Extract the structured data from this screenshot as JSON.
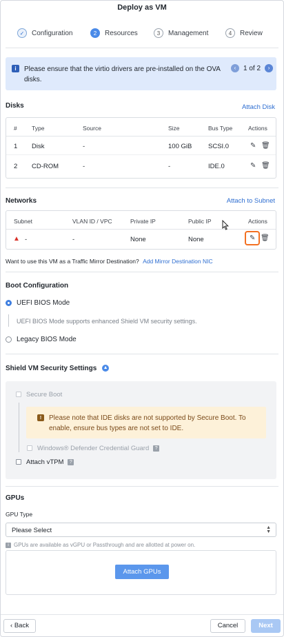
{
  "dialog": {
    "title": "Deploy as VM"
  },
  "steps": [
    {
      "num": "✓",
      "label": "Configuration"
    },
    {
      "num": "2",
      "label": "Resources"
    },
    {
      "num": "3",
      "label": "Management"
    },
    {
      "num": "4",
      "label": "Review"
    }
  ],
  "banner": {
    "message": "Please ensure that the virtio drivers are pre-installed on the OVA disks.",
    "pager": "1 of 2"
  },
  "disks": {
    "title": "Disks",
    "action": "Attach Disk",
    "columns": [
      "#",
      "Type",
      "Source",
      "Size",
      "Bus Type",
      "Actions"
    ],
    "rows": [
      {
        "num": "1",
        "type": "Disk",
        "source": "-",
        "size": "100 GiB",
        "bus": "SCSI.0"
      },
      {
        "num": "2",
        "type": "CD-ROM",
        "source": "-",
        "size": "-",
        "bus": "IDE.0"
      }
    ]
  },
  "networks": {
    "title": "Networks",
    "action": "Attach to Subnet",
    "columns": [
      "Subnet",
      "VLAN ID / VPC",
      "Private IP",
      "Public IP",
      "Actions"
    ],
    "rows": [
      {
        "subnet": "-",
        "vlan": "-",
        "private_ip": "None",
        "public_ip": "None"
      }
    ]
  },
  "mirror": {
    "question": "Want to use this VM as a Traffic Mirror Destination?",
    "link": "Add Mirror Destination NIC"
  },
  "boot": {
    "title": "Boot Configuration",
    "uefi_label": "UEFI BIOS Mode",
    "uefi_help": "UEFI BIOS Mode supports enhanced Shield VM security settings.",
    "legacy_label": "Legacy BIOS Mode"
  },
  "shield": {
    "title": "Shield VM Security Settings",
    "secure_boot": "Secure Boot",
    "warning": "Please note that IDE disks are not supported by Secure Boot. To enable, ensure bus types are not set to IDE.",
    "credential_guard": "Windows® Defender Credential Guard",
    "vtpm": "Attach vTPM"
  },
  "gpus": {
    "title": "GPUs",
    "type_label": "GPU Type",
    "select_value": "Please Select",
    "note": "GPUs are available as vGPU or Passthrough and are allotted at power on.",
    "attach_button": "Attach GPUs"
  },
  "footer": {
    "back": "Back",
    "cancel": "Cancel",
    "next": "Next"
  },
  "colors": {
    "accent": "#4a8ae8",
    "link": "#2e6ed1",
    "banner_bg": "#dfeafc",
    "warning_bg": "#fdf1d9",
    "highlight": "#f37021",
    "error": "#d9342b"
  },
  "icons": [
    "check-icon",
    "info-icon",
    "chevron-left-icon",
    "chevron-right-icon",
    "pencil-icon",
    "trash-icon",
    "alert-triangle-icon",
    "chevron-up-icon",
    "warning-icon",
    "question-icon",
    "caret-updown-icon",
    "mouse-cursor-icon"
  ]
}
